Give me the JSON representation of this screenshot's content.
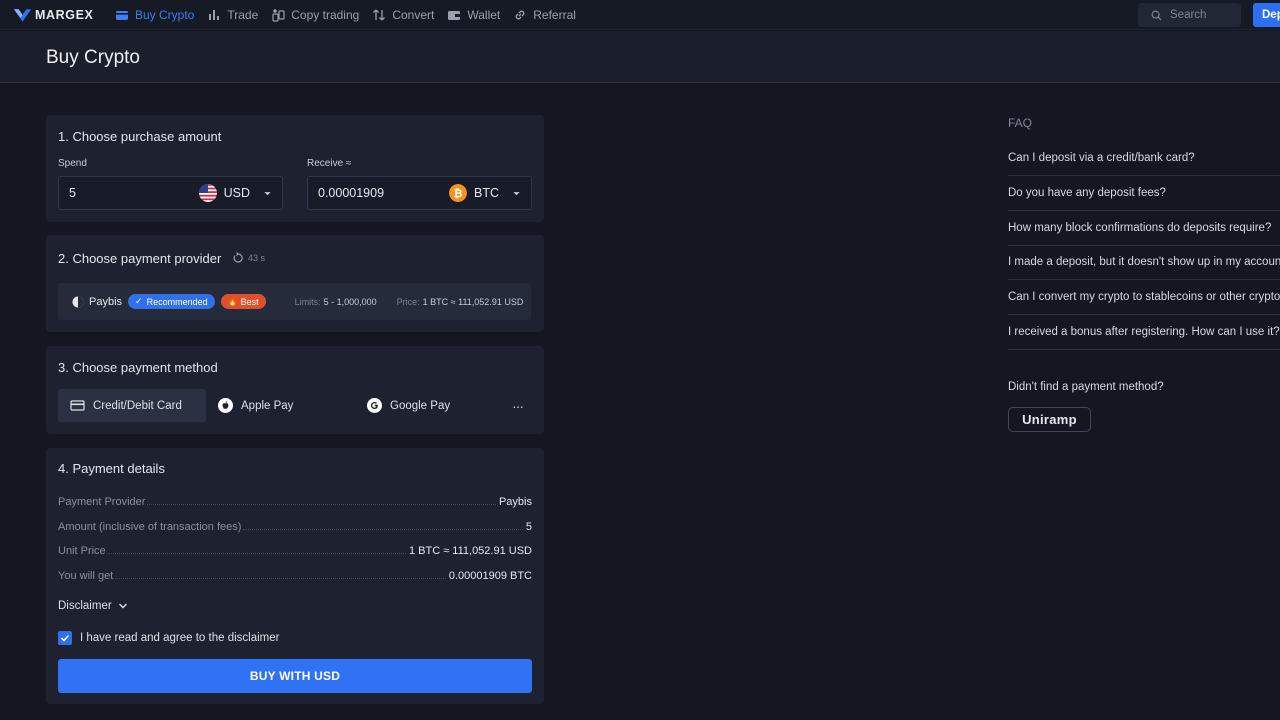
{
  "nav": {
    "brand": "MARGEX",
    "items": [
      {
        "label": "Buy Crypto",
        "icon": "card-icon",
        "active": true
      },
      {
        "label": "Trade",
        "icon": "bar-chart-icon",
        "active": false
      },
      {
        "label": "Copy trading",
        "icon": "copy-trading-icon",
        "active": false
      },
      {
        "label": "Convert",
        "icon": "convert-icon",
        "active": false
      },
      {
        "label": "Wallet",
        "icon": "wallet-icon",
        "active": false
      },
      {
        "label": "Referral",
        "icon": "link-icon",
        "active": false
      }
    ],
    "search_placeholder": "Search",
    "deposit_label": "Dep"
  },
  "page": {
    "title": "Buy Crypto"
  },
  "step1": {
    "title": "1.  Choose purchase amount",
    "spend_label": "Spend",
    "spend_value": "5",
    "spend_currency": "USD",
    "receive_label": "Receive ≈",
    "receive_value": "0.00001909",
    "receive_currency": "BTC"
  },
  "step2": {
    "title": "2.  Choose payment provider",
    "timer": "43 s",
    "provider": {
      "name": "Paybis",
      "badge_recommended": "Recommended",
      "badge_best": "Best",
      "limits_label": "Limits:",
      "limits_value": "5 - 1,000,000",
      "price_label": "Price:",
      "price_value": "1 BTC ≈ 111,052.91 USD"
    }
  },
  "step3": {
    "title": "3.  Choose payment method",
    "methods": [
      {
        "label": "Credit/Debit Card",
        "icon": "card-icon",
        "selected": true
      },
      {
        "label": "Apple Pay",
        "icon": "apple-icon",
        "selected": false
      },
      {
        "label": "Google Pay",
        "icon": "google-icon",
        "selected": false
      }
    ],
    "more_label": "···"
  },
  "step4": {
    "title": "4.  Payment details",
    "rows": [
      {
        "label": "Payment Provider",
        "value": "Paybis"
      },
      {
        "label": "Amount (inclusive of transaction fees)",
        "value": "5"
      },
      {
        "label": "Unit Price",
        "value": "1 BTC ≈ 111,052.91 USD"
      },
      {
        "label": "You will get",
        "value": "0.00001909 BTC"
      }
    ],
    "disclaimer_label": "Disclaimer",
    "agree_label": "I have read and agree to the disclaimer",
    "agree_checked": true,
    "buy_label": "BUY WITH USD"
  },
  "faq": {
    "title": "FAQ",
    "items": [
      "Can I deposit via a credit/bank card?",
      "Do you have any deposit fees?",
      "How many block confirmations do deposits require?",
      "I made a deposit, but it doesn't show up in my account",
      "Can I convert my crypto to stablecoins or other crypto?",
      "I received a bonus after registering. How can I use it?"
    ],
    "not_found": "Didn't find a payment method?",
    "uniramp_label": "Uniramp"
  },
  "colors": {
    "accent": "#2f72f4",
    "background": "#141722",
    "card": "#1d2130",
    "best_badge": "#e0502a",
    "btc": "#f7931a"
  }
}
